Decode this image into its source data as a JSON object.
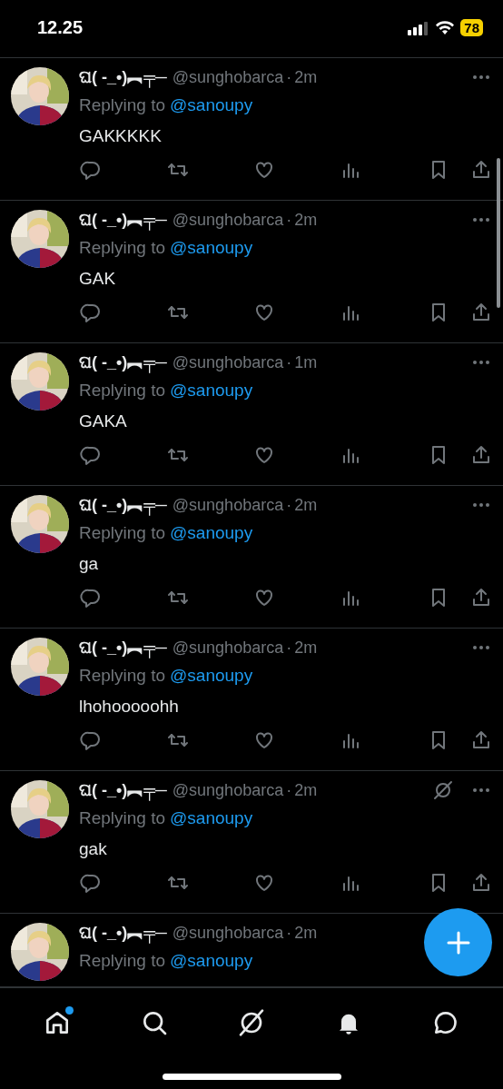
{
  "status_bar": {
    "time": "12.25",
    "battery": "78"
  },
  "tweets": [
    {
      "name": "ଘ( -_•)︻╤─",
      "handle": "@sunghobarca",
      "dot": "·",
      "time": "2m",
      "replying_prefix": "Replying to",
      "replying_to": "@sanoupy",
      "body": "GAKKKKK",
      "circle_icon": false
    },
    {
      "name": "ଘ( -_•)︻╤─",
      "handle": "@sunghobarca",
      "dot": "·",
      "time": "2m",
      "replying_prefix": "Replying to",
      "replying_to": "@sanoupy",
      "body": "GAK",
      "circle_icon": false
    },
    {
      "name": "ଘ( -_•)︻╤─",
      "handle": "@sunghobarca",
      "dot": "·",
      "time": "1m",
      "replying_prefix": "Replying to",
      "replying_to": "@sanoupy",
      "body": "GAKA",
      "circle_icon": false
    },
    {
      "name": "ଘ( -_•)︻╤─",
      "handle": "@sunghobarca",
      "dot": "·",
      "time": "2m",
      "replying_prefix": "Replying to",
      "replying_to": "@sanoupy",
      "body": "ga",
      "circle_icon": false
    },
    {
      "name": "ଘ( -_•)︻╤─",
      "handle": "@sunghobarca",
      "dot": "·",
      "time": "2m",
      "replying_prefix": "Replying to",
      "replying_to": "@sanoupy",
      "body": "lhohooooohh",
      "circle_icon": false
    },
    {
      "name": "ଘ( -_•)︻╤─",
      "handle": "@sunghobarca",
      "dot": "·",
      "time": "2m",
      "replying_prefix": "Replying to",
      "replying_to": "@sanoupy",
      "body": "gak",
      "circle_icon": true
    },
    {
      "name": "ଘ( -_•)︻╤─",
      "handle": "@sunghobarca",
      "dot": "·",
      "time": "2m",
      "replying_prefix": "Replying to",
      "replying_to": "@sanoupy",
      "circle_icon": false
    }
  ],
  "tab_bar": [
    {
      "kind": "home",
      "badge": true
    },
    {
      "kind": "search",
      "badge": false
    },
    {
      "kind": "grok",
      "badge": false
    },
    {
      "kind": "notifications",
      "badge": false
    },
    {
      "kind": "messages",
      "badge": false
    }
  ]
}
